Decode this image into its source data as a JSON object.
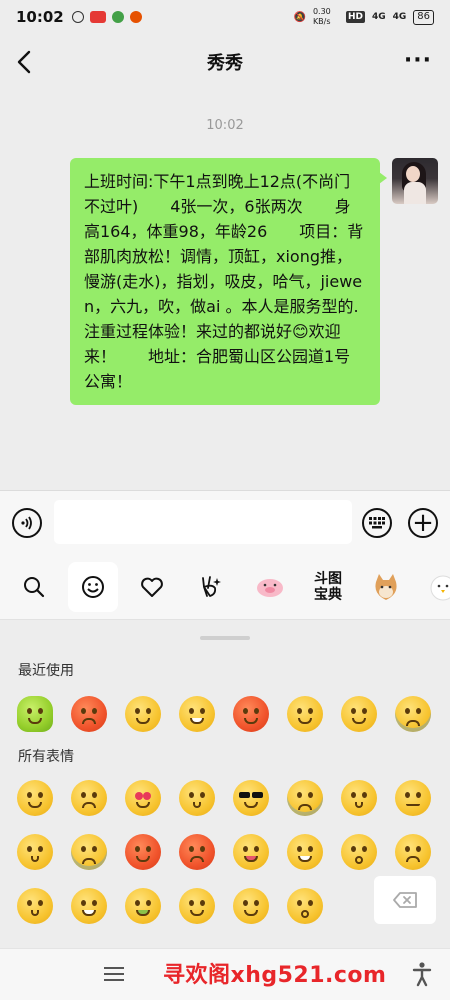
{
  "status": {
    "time": "10:02",
    "speed": "0.30 KB/s",
    "hd": "HD",
    "net1": "4G",
    "net2": "4G",
    "battery": "86"
  },
  "header": {
    "title": "秀秀",
    "more": "···"
  },
  "chat": {
    "timestamp": "10:02",
    "message": "上班时间:下午1点到晚上12点(不尚门不过叶)　　4张一次，6张两次　　身高164，体重98，年龄26　　项目：背部肌肉放松！调情，顶缸，xiong推，慢游(走水)，指划，吸皮，哈气，jiewen，六九，吹，做ai 。本人是服务型的.注重过程体验！来过的都说好😊欢迎来！　　地址：合肥蜀山区公园道1号公寓！"
  },
  "tabs": {
    "doutu_line1": "斗图",
    "doutu_line2": "宝典"
  },
  "emoji_panel": {
    "recent_label": "最近使用",
    "all_label": "所有表情"
  },
  "navbar": {
    "watermark": "寻欢阁xhg521.com"
  },
  "colors": {
    "bubble": "#95ec69",
    "background": "#ededed",
    "watermark": "#e8262a"
  }
}
